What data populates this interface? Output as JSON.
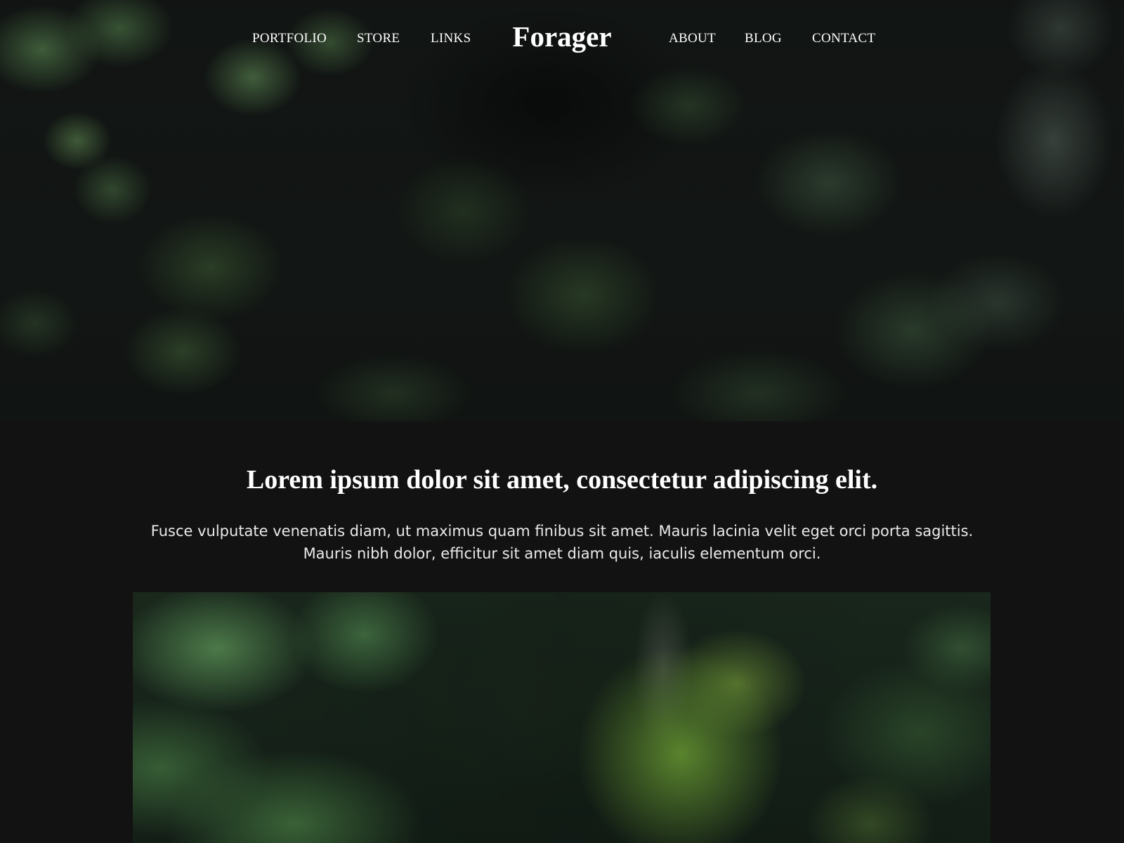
{
  "nav": {
    "left_links": [
      {
        "label": "PORTFOLIO"
      },
      {
        "label": "STORE"
      },
      {
        "label": "LINKS"
      }
    ],
    "right_links": [
      {
        "label": "ABOUT"
      },
      {
        "label": "BLOG"
      },
      {
        "label": "CONTACT"
      }
    ]
  },
  "brand": {
    "name": "Forager"
  },
  "intro": {
    "headline": "Lorem ipsum dolor sit amet, consectetur adipiscing elit.",
    "body_line_1": "Fusce vulputate venenatis diam, ut maximus quam finibus sit amet. Mauris lacinia velit eget orci porta sagittis.",
    "body_line_2": "Mauris nibh dolor, efficitur sit amet diam quis, iaculis elementum orci."
  },
  "colors": {
    "page_background": "#121212",
    "text": "#ffffff"
  }
}
